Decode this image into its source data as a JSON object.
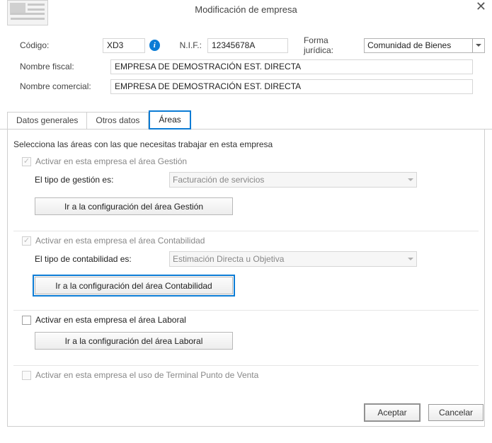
{
  "dialog": {
    "title": "Modificación de empresa"
  },
  "header": {
    "labels": {
      "codigo": "Código:",
      "nif": "N.I.F.:",
      "forma": "Forma jurídica:",
      "fiscal": "Nombre fiscal:",
      "comercial": "Nombre comercial:"
    },
    "values": {
      "codigo": "XD3",
      "nif": "12345678A",
      "forma": "Comunidad de Bienes",
      "fiscal": "EMPRESA DE DEMOSTRACIÓN EST. DIRECTA",
      "comercial": "EMPRESA DE DEMOSTRACIÓN EST. DIRECTA"
    }
  },
  "tabs": {
    "t0": "Datos generales",
    "t1": "Otros datos",
    "t2": "Áreas"
  },
  "areas": {
    "intro": "Selecciona las áreas con las que necesitas trabajar en esta empresa",
    "gestion": {
      "checkbox": "Activar en esta empresa el área Gestión",
      "tipo_label": "El tipo de gestión es:",
      "tipo_val": "Facturación de servicios",
      "btn": "Ir a la configuración del área Gestión"
    },
    "contabilidad": {
      "checkbox": "Activar en esta empresa el área Contabilidad",
      "tipo_label": "El tipo de contabilidad es:",
      "tipo_val": "Estimación Directa u Objetiva",
      "btn": "Ir a la configuración del área Contabilidad"
    },
    "laboral": {
      "checkbox": "Activar en esta empresa el área Laboral",
      "btn": "Ir a la configuración del área Laboral"
    },
    "tpv": {
      "checkbox": "Activar en esta empresa el uso de Terminal Punto de Venta"
    }
  },
  "footer": {
    "accept": "Aceptar",
    "cancel": "Cancelar"
  }
}
